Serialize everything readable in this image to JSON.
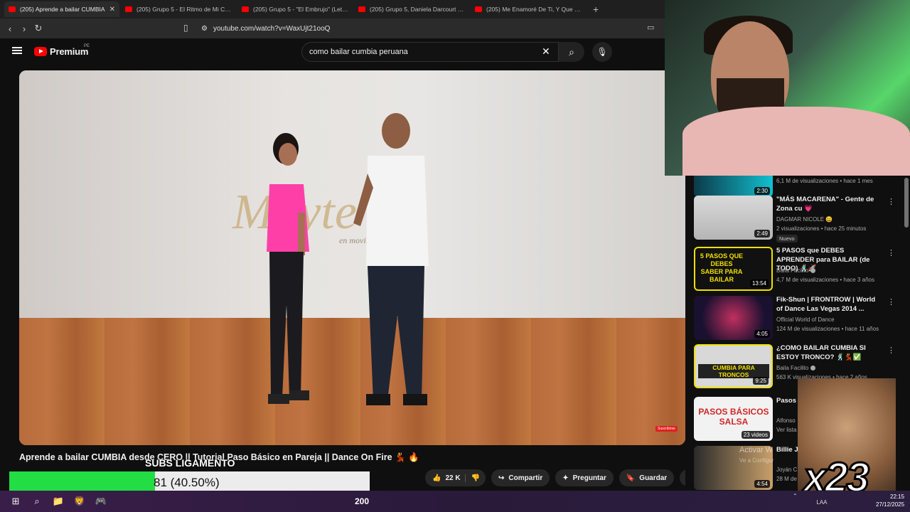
{
  "browser": {
    "tabs": [
      {
        "label": "(205) Aprende a bailar CUMBIA",
        "active": true
      },
      {
        "label": "(205) Grupo 5 - El Ritmo de Mi Corazón",
        "active": false
      },
      {
        "label": "(205) Grupo 5 - \"El Embrujo\" (Letra)",
        "active": false
      },
      {
        "label": "(205) Grupo 5, Daniela Darcourt - Qu",
        "active": false
      },
      {
        "label": "(205) Me Enamoré De Ti, Y Que - You",
        "active": false
      }
    ],
    "url": "youtube.com/watch?v=WaxUjt21ooQ"
  },
  "youtube": {
    "brand": "Premium",
    "country": "PE",
    "search_value": "como bailar cumbia peruana"
  },
  "video": {
    "watermark": "Mayte",
    "watermark_sub": "en movimiento",
    "subscribe_badge": "Suscribirse",
    "title": "Aprende a bailar CUMBIA desde CERO || Tutorial Paso Básico en Pareja || Dance On Fire 💃 🔥",
    "likes": "22 K",
    "share": "Compartir",
    "ask": "Preguntar",
    "save": "Guardar"
  },
  "overlay": {
    "title": "SUBS LIGAMENTO",
    "count_text": "81 (40.50%)",
    "progress": 0.405,
    "bar_color": "#22dd44"
  },
  "recommendations": [
    {
      "title": "",
      "channel": "",
      "meta": "6,1 M de visualizaciones • hace 1 mes",
      "duration": "2:30"
    },
    {
      "title": "\"MÁS MACARENA\" - Gente de Zona cu 💗",
      "channel": "DAGMAR NICOLE 😀",
      "meta": "2 visualizaciones • hace 25 minutos",
      "duration": "2:49",
      "badge": "Nuevo"
    },
    {
      "title": "5 PASOS que DEBES APRENDER para BAILAR (de TODO) 🕺🚀",
      "channel": "Baila Facilito",
      "meta": "4,7 M de visualizaciones • hace 3 años",
      "duration": "13:54",
      "thumb_text": "5 PASOS QUE DEBES SABER PARA BAILAR"
    },
    {
      "title": "Fik-Shun | FRONTROW | World of Dance Las Vegas 2014 ...",
      "channel": "Official World of Dance",
      "meta": "124 M de visualizaciones • hace 11 años",
      "duration": "4:05"
    },
    {
      "title": "¿COMO BAILAR CUMBIA SI ESTOY TRONCO? 🕺💃✅",
      "channel": "Baila Facilito",
      "meta": "563 K visualizaciones • hace 2 años",
      "duration": "9:25",
      "thumb_text": "CUMBIA PARA TRONCOS"
    },
    {
      "title": "Pasos Básicos Aprende",
      "channel": "Alfonso",
      "meta": "Ver lista",
      "duration": "23 videos",
      "thumb_text": "PASOS BÁSICOS SALSA"
    },
    {
      "title": "Billie Jean Joyan",
      "channel": "Joyán C",
      "meta": "28 M de visualizaciones • hace 6 a",
      "duration": "4:54"
    }
  ],
  "stream_overlay": {
    "multiplier": "x23",
    "windows_watermark": "Activar W",
    "windows_watermark_sub": "Ve a Configur"
  },
  "taskbar": {
    "center_number": "200",
    "language": "LAA",
    "time": "22:15",
    "date": "27/12/2025"
  }
}
